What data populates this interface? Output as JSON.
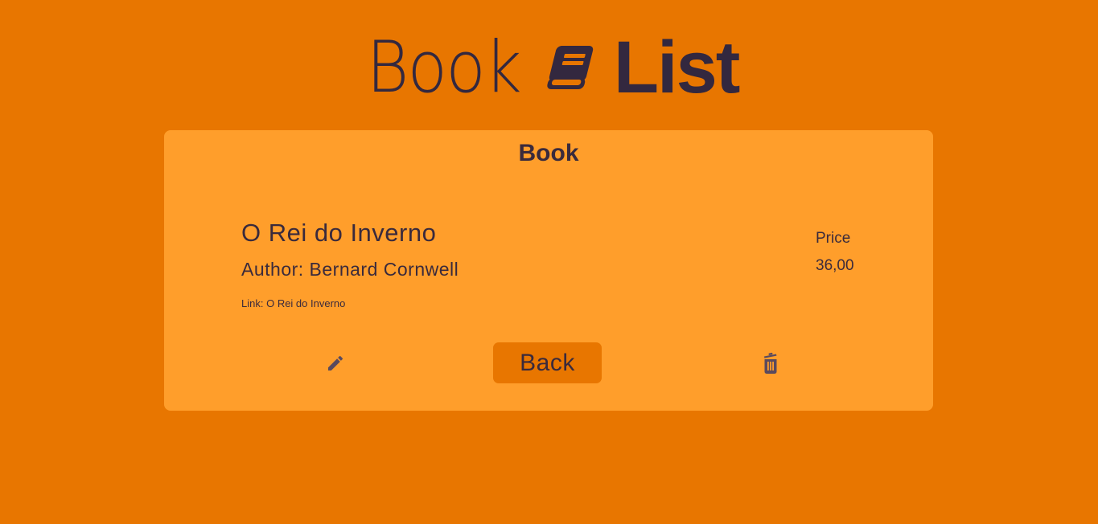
{
  "header": {
    "logo_light": "Book",
    "logo_bold": "List",
    "logo_icon": "book-icon"
  },
  "card": {
    "title": "Book",
    "book": {
      "name": "O Rei do Inverno",
      "author": "Author: Bernard Cornwell",
      "link_prefix": "Link:",
      "link_text": "O Rei do Inverno"
    },
    "price": {
      "label": "Price",
      "value": "36,00"
    },
    "actions": {
      "edit_icon": "pencil-icon",
      "back_label": "Back",
      "delete_icon": "trash-icon"
    }
  },
  "colors": {
    "background": "#e87600",
    "card": "#ff9e2b",
    "text": "#3a2a3c",
    "logo": "#33283f",
    "icon": "#5a4a5e"
  }
}
